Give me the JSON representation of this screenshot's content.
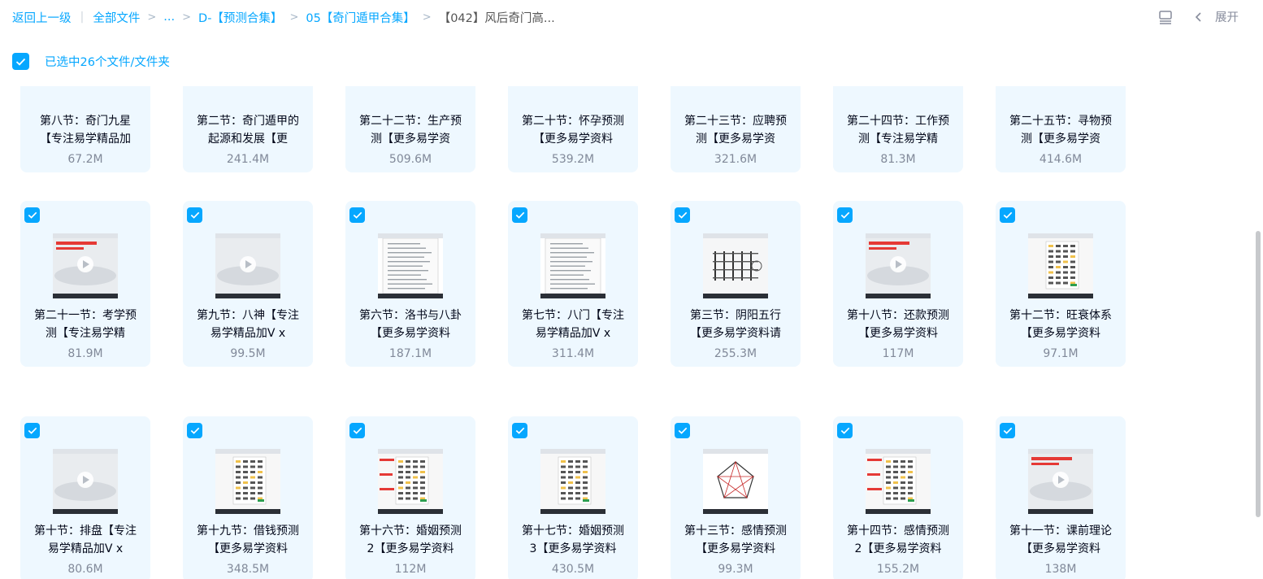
{
  "breadcrumb": {
    "back": "返回上一级",
    "all_files": "全部文件",
    "ellipsis": "...",
    "folder1": "D-【预测合集】",
    "folder2": "05【奇门遁甲合集】",
    "current": "【042】风后奇门高..."
  },
  "toolbar": {
    "expand": "展开"
  },
  "selection": {
    "text": "已选中26个文件/文件夹"
  },
  "files": [
    {
      "name": "第八节：奇门九星【专注易学精品加",
      "size": "67.2M",
      "checked": false,
      "thumb": "none"
    },
    {
      "name": "第二节：奇门遁甲的起源和发展【更",
      "size": "241.4M",
      "checked": false,
      "thumb": "none"
    },
    {
      "name": "第二十二节：生产预测【更多易学资",
      "size": "509.6M",
      "checked": false,
      "thumb": "none"
    },
    {
      "name": "第二十节：怀孕预测【更多易学资料",
      "size": "539.2M",
      "checked": false,
      "thumb": "none"
    },
    {
      "name": "第二十三节：应聘预测【更多易学资",
      "size": "321.6M",
      "checked": false,
      "thumb": "none"
    },
    {
      "name": "第二十四节：工作预测【专注易学精",
      "size": "81.3M",
      "checked": false,
      "thumb": "none"
    },
    {
      "name": "第二十五节：寻物预测【更多易学资",
      "size": "414.6M",
      "checked": false,
      "thumb": "none"
    },
    {
      "name": "第二十一节：考学预测【专注易学精",
      "size": "81.9M",
      "checked": true,
      "thumb": "video-red"
    },
    {
      "name": "第九节：八神【专注易学精品加V x",
      "size": "99.5M",
      "checked": true,
      "thumb": "video"
    },
    {
      "name": "第六节：洛书与八卦【更多易学资料",
      "size": "187.1M",
      "checked": true,
      "thumb": "doc"
    },
    {
      "name": "第七节：八门【专注易学精品加V x",
      "size": "311.4M",
      "checked": true,
      "thumb": "doc"
    },
    {
      "name": "第三节：阴阳五行【更多易学资料请",
      "size": "255.3M",
      "checked": true,
      "thumb": "grid"
    },
    {
      "name": "第十八节：还款预测【更多易学资料",
      "size": "117M",
      "checked": true,
      "thumb": "video-red"
    },
    {
      "name": "第十二节：旺衰体系【更多易学资料",
      "size": "97.1M",
      "checked": true,
      "thumb": "table"
    },
    {
      "name": "第十节：排盘【专注易学精品加V x",
      "size": "80.6M",
      "checked": true,
      "thumb": "video"
    },
    {
      "name": "第十九节：借钱预测【更多易学资料",
      "size": "348.5M",
      "checked": true,
      "thumb": "table"
    },
    {
      "name": "第十六节：婚姻预测2【更多易学资料",
      "size": "112M",
      "checked": true,
      "thumb": "table-red"
    },
    {
      "name": "第十七节：婚姻预测3【更多易学资料",
      "size": "430.5M",
      "checked": true,
      "thumb": "table"
    },
    {
      "name": "第十三节：感情预测【更多易学资料",
      "size": "99.3M",
      "checked": true,
      "thumb": "circle"
    },
    {
      "name": "第十四节：感情预测2【更多易学资料",
      "size": "155.2M",
      "checked": true,
      "thumb": "table-red"
    },
    {
      "name": "第十一节：课前理论【更多易学资料",
      "size": "138M",
      "checked": true,
      "thumb": "video-red"
    }
  ]
}
